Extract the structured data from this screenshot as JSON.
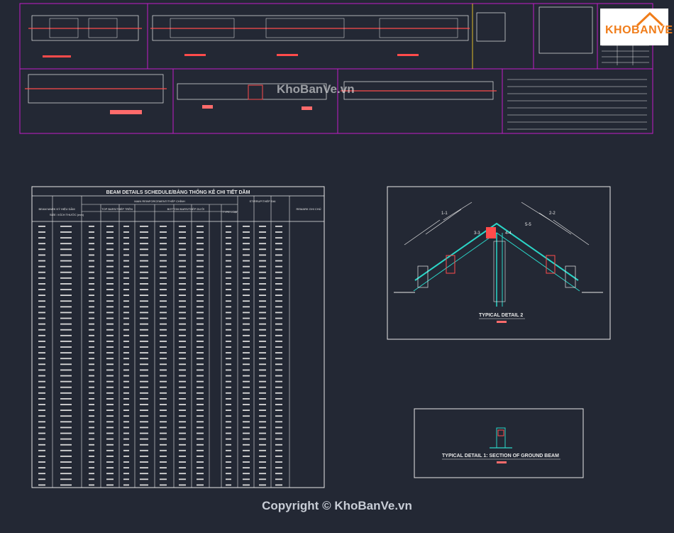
{
  "brand": {
    "logo_text": "KHOBANVE",
    "watermark": "KhoBanVe.vn",
    "copyright": "Copyright © KhoBanVe.vn"
  },
  "schedule": {
    "title": "BEAM DETAILS SCHEDULE/BẢNG THỐNG KÊ CHI TIẾT DẦM",
    "col_mark": "BEAM MARK KÝ HIỆU DẦM",
    "col_size": "SIZE / KÍCH THƯỚC (mm)",
    "col_main": "MAIN REINFORCEMENT/THÉP CHÍNH",
    "col_top": "TOP BARS/THÉP TRÊN",
    "col_bottom": "BOTTOM BARS/THÉP DƯỚI",
    "col_typ": "TYPE LOẠI",
    "col_stirrup": "STIRRUP/THÉP ĐAI",
    "col_remark": "REMARK GHI CHÚ"
  },
  "details": {
    "typical2": "TYPICAL DETAIL 2",
    "typical1": "TYPICAL DETAIL 1: SECTION OF GROUND BEAM",
    "labels": [
      "1-1",
      "2-2",
      "3-3",
      "4-4",
      "5-5"
    ]
  },
  "colors": {
    "bg": "#232834",
    "magenta": "#c21bc8",
    "white": "#e8e8e8",
    "red": "#ff4b4b",
    "cyan": "#2bd6c8",
    "grey": "#9aa0a8"
  }
}
